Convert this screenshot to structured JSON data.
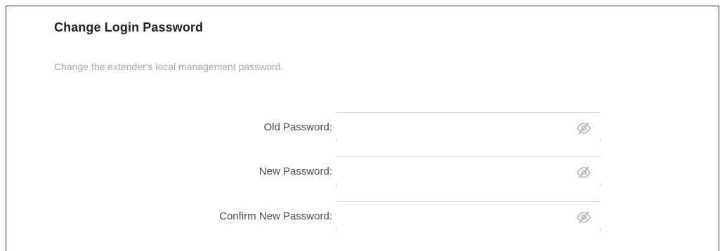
{
  "section": {
    "title": "Change Login Password",
    "description": "Change the extender's local management password."
  },
  "fields": [
    {
      "label": "Old Password:",
      "value": "",
      "placeholder": ""
    },
    {
      "label": "New Password:",
      "value": "",
      "placeholder": ""
    },
    {
      "label": "Confirm New Password:",
      "value": "",
      "placeholder": ""
    }
  ],
  "icons": {
    "toggle_visibility": "eye-slash-icon"
  },
  "colors": {
    "title": "#222222",
    "description": "#a6a6a6",
    "label": "#4a4a4a",
    "border": "#2b2b2b",
    "input_border": "#d9d9d9",
    "icon": "#b3b3b3"
  }
}
